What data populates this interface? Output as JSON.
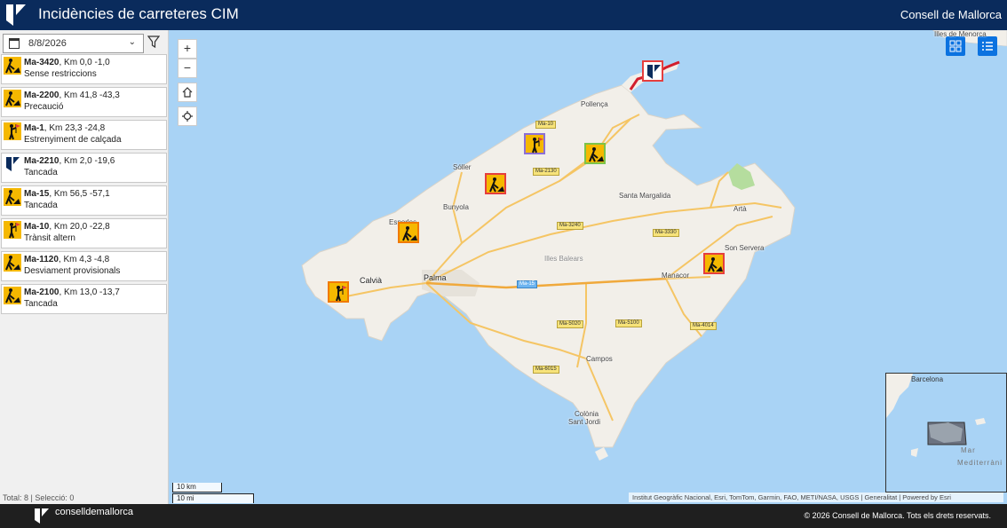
{
  "header": {
    "title": "Incidències de carreteres CIM",
    "org": "Consell de Mallorca"
  },
  "sidebar": {
    "date": "8/8/2026",
    "items": [
      {
        "road": "Ma-3420",
        "km": ", Km 0,0 -1,0",
        "status": "Sense restriccions",
        "icon": "roadwork-icon"
      },
      {
        "road": "Ma-2200",
        "km": ", Km 41,8 -43,3",
        "status": "Precaució",
        "icon": "roadwork-icon"
      },
      {
        "road": "Ma-1",
        "km": ", Km 23,3 -24,8",
        "status": "Estrenyiment de calçada",
        "icon": "flagger-icon"
      },
      {
        "road": "Ma-2210",
        "km": ", Km 2,0 -19,6",
        "status": "Tancada",
        "icon": "closed-icon"
      },
      {
        "road": "Ma-15",
        "km": ", Km 56,5 -57,1",
        "status": "Tancada",
        "icon": "roadwork-icon"
      },
      {
        "road": "Ma-10",
        "km": ", Km 20,0 -22,8",
        "status": "Trànsit altern",
        "icon": "flagger-icon"
      },
      {
        "road": "Ma-1120",
        "km": ", Km 4,3 -4,8",
        "status": "Desviament provisionals",
        "icon": "roadwork-icon"
      },
      {
        "road": "Ma-2100",
        "km": ", Km 13,0 -13,7",
        "status": "Tancada",
        "icon": "roadwork-icon"
      }
    ],
    "total": "Total: 8 | Selecció: 0"
  },
  "map": {
    "zoom_in": "+",
    "zoom_out": "−",
    "places": {
      "menorca": "Illes de Menorca",
      "pollenca": "Pollença",
      "soller": "Sóller",
      "bunyola": "Bunyola",
      "esporles": "Esporles",
      "calvia": "Calvià",
      "palma": "Palma",
      "santa_margalida": "Santa Margalida",
      "arta": "Artà",
      "son_servera": "Son Servera",
      "manacor": "Manacor",
      "illes_balears": "Illes Balears",
      "campos": "Campos",
      "colonia": "Colònia",
      "sant_jordi": "Sant Jordi"
    },
    "road_labels": {
      "ma10": "Ma-10",
      "ma2130": "Ma-2130",
      "ma3240": "Ma-3240",
      "ma3330": "Ma-3330",
      "ma15": "Ma-15",
      "ma5020": "Ma-5020",
      "ma5100": "Ma-5100",
      "ma4014": "Ma-4014",
      "ma6015": "Ma-6015"
    },
    "overview": {
      "barcelona": "Barcelona",
      "mar": "Mar",
      "mediterrani": "Mediterràni"
    },
    "scale_km": "10 km",
    "scale_mi": "10 mi",
    "attribution": "Institut Geogràfic Nacional, Esri, TomTom, Garmin, FAO, METI/NASA, USGS | Generalitat | Powered by Esri"
  },
  "footer": {
    "brand": "conselldemallorca",
    "copyright": "© 2026 Consell de Mallorca. Tots els drets reservats."
  },
  "colors": {
    "header": "#0a2b5c",
    "accent": "#0b72e0",
    "marker": "#f5b800",
    "footer": "#1f1f1f"
  }
}
